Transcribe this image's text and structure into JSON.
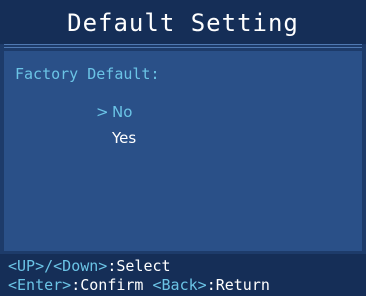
{
  "header": {
    "title": "Default Setting"
  },
  "section": {
    "label": "Factory Default:"
  },
  "options": [
    {
      "cursor": ">",
      "label": "No",
      "selected": true
    },
    {
      "cursor": "",
      "label": "Yes",
      "selected": false
    }
  ],
  "footer": {
    "line1": {
      "key1": "<UP>/<Down>",
      "action1": ":Select"
    },
    "line2": {
      "key1": "<Enter>",
      "action1": ":Confirm ",
      "key2": "<Back>",
      "action2": ":Return"
    }
  },
  "colors": {
    "background": "#1d3b6a",
    "panel": "#2a5088",
    "accent": "#6bc4e6",
    "text": "#ffffff"
  }
}
